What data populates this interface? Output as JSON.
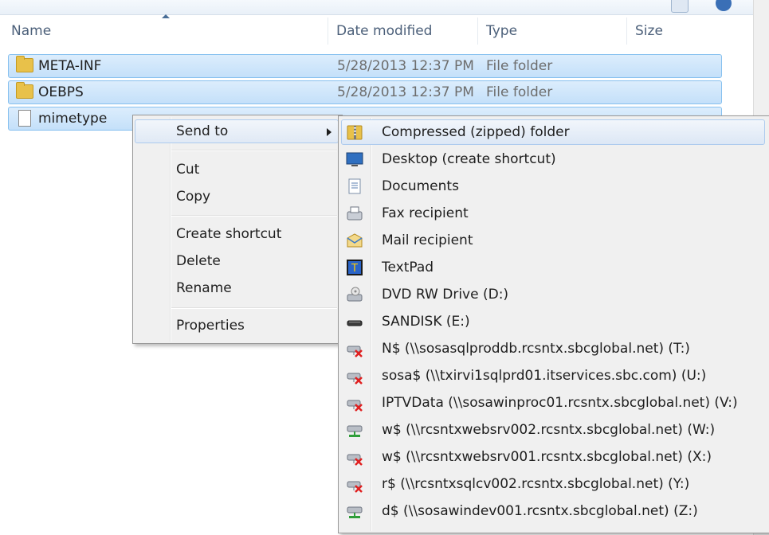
{
  "columns": {
    "name": "Name",
    "date_modified": "Date modified",
    "type": "Type",
    "size": "Size"
  },
  "files": [
    {
      "name": "META-INF",
      "date": "5/28/2013 12:37 PM",
      "type": "File folder",
      "icon": "folder-icon"
    },
    {
      "name": "OEBPS",
      "date": "5/28/2013 12:37 PM",
      "type": "File folder",
      "icon": "folder-icon"
    },
    {
      "name": "mimetype",
      "date": "",
      "type": "",
      "icon": "file-icon"
    }
  ],
  "context_menu": {
    "send_to": "Send to",
    "cut": "Cut",
    "copy": "Copy",
    "create_shortcut": "Create shortcut",
    "delete": "Delete",
    "rename": "Rename",
    "properties": "Properties"
  },
  "send_to_menu": [
    {
      "label": "Compressed (zipped) folder",
      "icon": "zip-folder-icon"
    },
    {
      "label": "Desktop (create shortcut)",
      "icon": "desktop-icon"
    },
    {
      "label": "Documents",
      "icon": "documents-icon"
    },
    {
      "label": "Fax recipient",
      "icon": "fax-icon"
    },
    {
      "label": "Mail recipient",
      "icon": "mail-icon"
    },
    {
      "label": "TextPad",
      "icon": "textpad-icon"
    },
    {
      "label": "DVD RW Drive (D:)",
      "icon": "dvd-drive-icon"
    },
    {
      "label": "SANDISK (E:)",
      "icon": "usb-drive-icon"
    },
    {
      "label": "N$ (\\\\sosasqlproddb.rcsntx.sbcglobal.net) (T:)",
      "icon": "network-drive-disconnected-icon"
    },
    {
      "label": "sosa$ (\\\\txirvi1sqlprd01.itservices.sbc.com) (U:)",
      "icon": "network-drive-disconnected-icon"
    },
    {
      "label": "IPTVData (\\\\sosawinproc01.rcsntx.sbcglobal.net) (V:)",
      "icon": "network-drive-disconnected-icon"
    },
    {
      "label": "w$ (\\\\rcsntxwebsrv002.rcsntx.sbcglobal.net) (W:)",
      "icon": "network-drive-connected-icon"
    },
    {
      "label": "w$ (\\\\rcsntxwebsrv001.rcsntx.sbcglobal.net) (X:)",
      "icon": "network-drive-disconnected-icon"
    },
    {
      "label": "r$ (\\\\rcsntxsqlcv002.rcsntx.sbcglobal.net) (Y:)",
      "icon": "network-drive-disconnected-icon"
    },
    {
      "label": "d$ (\\\\sosawindev001.rcsntx.sbcglobal.net) (Z:)",
      "icon": "network-drive-connected-icon"
    }
  ],
  "colors": {
    "selection": "#cce4f9",
    "selection_border": "#86c0ef",
    "menu_bg": "#f0f0f0",
    "header_text": "#4c607a"
  }
}
